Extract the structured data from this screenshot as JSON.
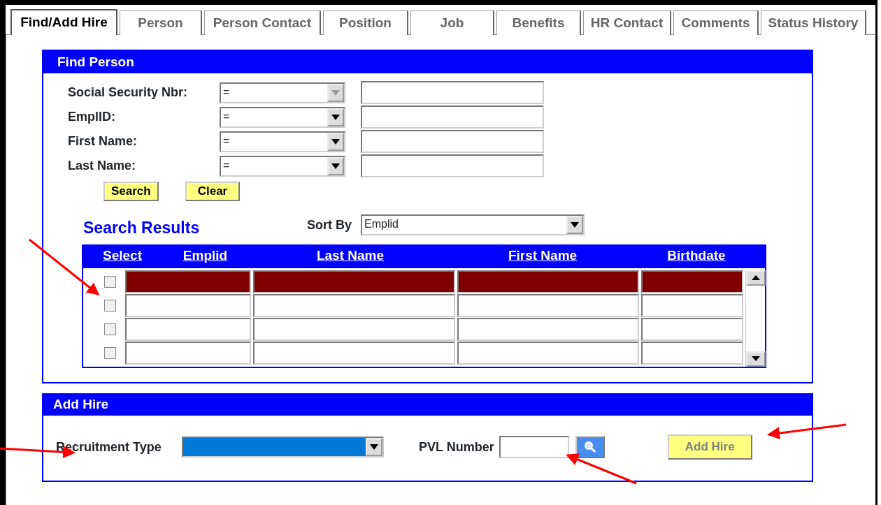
{
  "tabs": [
    {
      "label": "Find/Add Hire",
      "selected": true
    },
    {
      "label": "Person",
      "selected": false
    },
    {
      "label": "Person Contact",
      "selected": false
    },
    {
      "label": "Position",
      "selected": false
    },
    {
      "label": "Job",
      "selected": false
    },
    {
      "label": "Benefits",
      "selected": false
    },
    {
      "label": "HR Contact",
      "selected": false
    },
    {
      "label": "Comments",
      "selected": false
    },
    {
      "label": "Status History",
      "selected": false
    }
  ],
  "find_person": {
    "title": "Find Person",
    "fields": [
      {
        "label": "Social Security Nbr:",
        "operator": "=",
        "disabled": true
      },
      {
        "label": "EmplID:",
        "operator": "=",
        "disabled": false
      },
      {
        "label": "First Name:",
        "operator": "=",
        "disabled": false
      },
      {
        "label": "Last Name:",
        "operator": "=",
        "disabled": false
      }
    ],
    "buttons": [
      "Search",
      "Clear"
    ]
  },
  "search_results": {
    "title": "Search Results",
    "sort_by_label": "Sort By",
    "sort_by": "Emplid",
    "columns": [
      "Select",
      "Emplid",
      "Last Name",
      "First Name",
      "Birthdate"
    ],
    "rows": [
      {
        "selected": true,
        "checked": false
      },
      {
        "selected": false,
        "checked": false
      },
      {
        "selected": false,
        "checked": false
      },
      {
        "selected": false,
        "checked": false
      }
    ]
  },
  "add_hire": {
    "title": "Add Hire",
    "recruitment_type_label": "Recruitment Type",
    "recruitment_type_highlighted": true,
    "pvl_label": "PVL Number",
    "button": {
      "label": "Add Hire",
      "disabled": true
    }
  }
}
